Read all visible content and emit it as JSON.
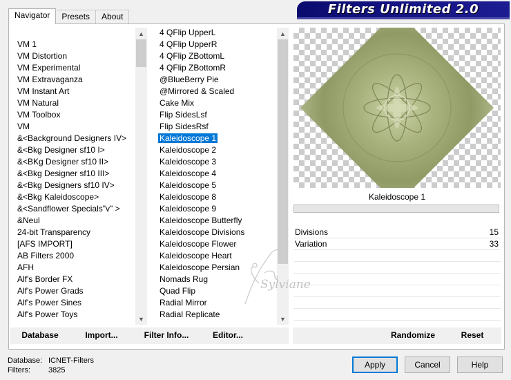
{
  "tabs": [
    {
      "label": "Navigator"
    },
    {
      "label": "Presets"
    },
    {
      "label": "About"
    }
  ],
  "banner": {
    "title": "Filters Unlimited 2.0"
  },
  "categories": [
    "VM 1",
    "VM Distortion",
    "VM Experimental",
    "VM Extravaganza",
    "VM Instant Art",
    "VM Natural",
    "VM Toolbox",
    "VM",
    "&<Background Designers IV>",
    "&<Bkg Designer sf10 I>",
    "&<BKg Designer sf10 II>",
    "&<Bkg Designer sf10 III>",
    "&<Bkg Designers sf10 IV>",
    "&<Bkg Kaleidoscope>",
    "&<Sandflower Specials\"v\" >",
    "&Neul",
    "24-bit Transparency",
    "[AFS IMPORT]",
    "AB Filters 2000",
    "AFH",
    "Alf's Border FX",
    "Alf's Power Grads",
    "Alf's Power Sines",
    "Alf's Power Toys"
  ],
  "filters": [
    "4 QFlip UpperL",
    "4 QFlip UpperR",
    "4 QFlip ZBottomL",
    "4 QFlip ZBottomR",
    "@BlueBerry Pie",
    "@Mirrored & Scaled",
    "Cake Mix",
    "Flip SidesLsf",
    "Flip SidesRsf",
    "Kaleidoscope 1",
    "Kaleidoscope 2",
    "Kaleidoscope 3",
    "Kaleidoscope 4",
    "Kaleidoscope 5",
    "Kaleidoscope 8",
    "Kaleidoscope 9",
    "Kaleidoscope Butterfly",
    "Kaleidoscope Divisions",
    "Kaleidoscope Flower",
    "Kaleidoscope Heart",
    "Kaleidoscope Persian",
    "Nomads Rug",
    "Quad Flip",
    "Radial Mirror",
    "Radial Replicate"
  ],
  "selected_filter_index": 9,
  "selected_filter": "Kaleidoscope 1",
  "params": [
    {
      "name": "Divisions",
      "value": "15"
    },
    {
      "name": "Variation",
      "value": "33"
    }
  ],
  "left_buttons": {
    "database": "Database",
    "import": "Import...",
    "filter_info": "Filter Info...",
    "editor": "Editor..."
  },
  "right_buttons": {
    "randomize": "Randomize",
    "reset": "Reset"
  },
  "footer": {
    "database_label": "Database:",
    "database_value": "ICNET-Filters",
    "filters_label": "Filters:",
    "filters_value": "3825",
    "apply": "Apply",
    "cancel": "Cancel",
    "help": "Help"
  },
  "watermark": {
    "text": "Sylviane"
  },
  "colors": {
    "banner": "#161688",
    "selection": "#0078d7",
    "preview_green": "#a9b37e"
  },
  "icons": {
    "scroll_up": "▲",
    "scroll_down": "▼"
  }
}
